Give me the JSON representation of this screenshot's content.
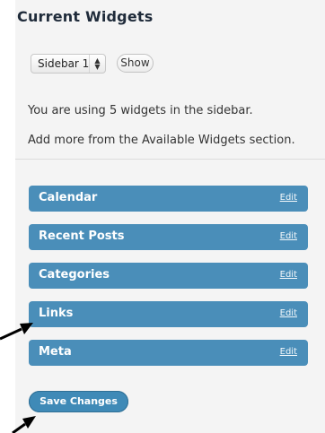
{
  "panel": {
    "title": "Current Widgets",
    "sidebar_select": {
      "value": "Sidebar 1",
      "arrows": "▲▼"
    },
    "show_button_label": "Show",
    "info_line_1": "You are using 5 widgets in the sidebar.",
    "info_line_2": "Add more from the Available Widgets section."
  },
  "widgets": [
    {
      "title": "Calendar",
      "edit_label": "Edit"
    },
    {
      "title": "Recent Posts",
      "edit_label": "Edit"
    },
    {
      "title": "Categories",
      "edit_label": "Edit"
    },
    {
      "title": "Links",
      "edit_label": "Edit"
    },
    {
      "title": "Meta",
      "edit_label": "Edit"
    }
  ],
  "save_button_label": "Save Changes",
  "colors": {
    "panel_bg": "#f4f4f4",
    "widget_bar": "#4a8eb9",
    "save_button": "#3f8ab7",
    "title_text": "#1f2b3a"
  },
  "icons": {
    "select_arrows": "up-down-arrows-icon",
    "annotation_arrow": "arrow-pointer-icon"
  }
}
